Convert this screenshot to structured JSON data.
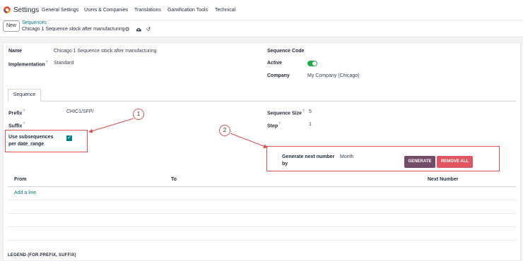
{
  "app": {
    "title": "Settings"
  },
  "nav": [
    "General Settings",
    "Users & Companies",
    "Translations",
    "Gamification Tools",
    "Technical"
  ],
  "control": {
    "new_label": "New",
    "breadcrumb_parent": "Sequences",
    "breadcrumb_current": "Chicago 1 Sequence stock after manufacturing"
  },
  "form": {
    "name_label": "Name",
    "name_value": "Chicago 1 Sequence stock after manufacturing",
    "implementation_label": "Implementation",
    "implementation_value": "Standard",
    "sequence_code_label": "Sequence Code",
    "active_label": "Active",
    "active": true,
    "company_label": "Company",
    "company_value": "My Company (Chicago)"
  },
  "tabs": [
    "Sequence"
  ],
  "sequence_tab": {
    "prefix_label": "Prefix",
    "prefix_value": "CHIC1/SFP/",
    "suffix_label": "Suffix",
    "suffix_value": "",
    "use_subsequences_label": "Use subsequences per date_range",
    "use_subsequences": true,
    "sequence_size_label": "Sequence Size",
    "sequence_size_value": "5",
    "step_label": "Step",
    "step_value": "1",
    "generate_by_label": "Generate next number by",
    "generate_by_value": "Month",
    "generate_button": "GENERATE",
    "remove_all_button": "REMOVE ALL"
  },
  "table": {
    "columns": [
      "From",
      "To",
      "Next Number"
    ],
    "add_line": "Add a line"
  },
  "legend_title": "LEGEND (FOR PREFIX, SUFFIX)",
  "annotations": [
    "1",
    "2"
  ],
  "colors": {
    "accent": "#017e84",
    "brand": "#714b67",
    "danger": "#e05560",
    "annotation": "#e14f4f",
    "toggle_on": "#28a745"
  }
}
